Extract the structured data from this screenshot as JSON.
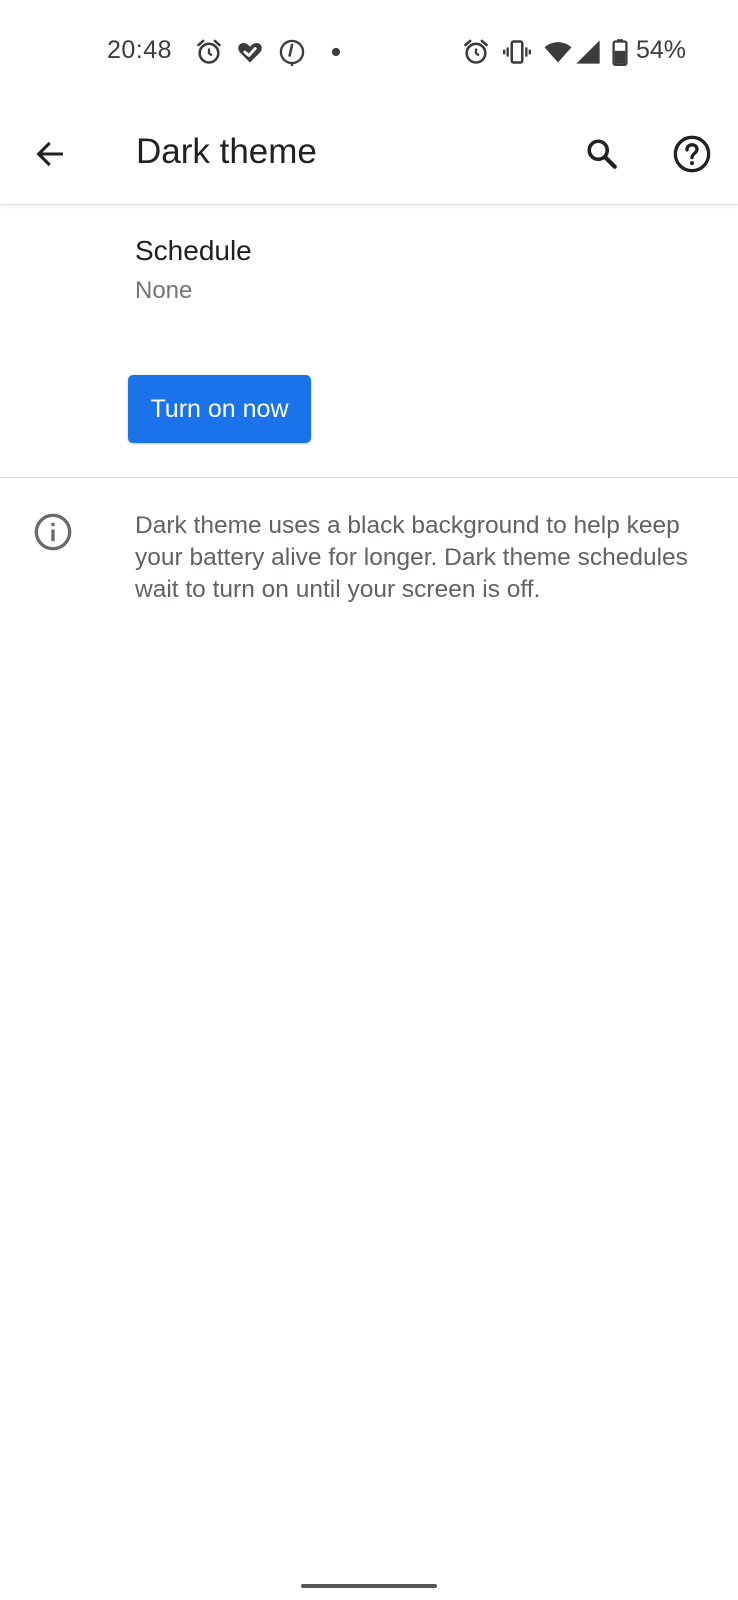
{
  "status_bar": {
    "time": "20:48",
    "battery_percent": "54%",
    "left_icons": [
      "alarm-icon",
      "heart-check-icon",
      "timer-icon",
      "notification-dot-icon"
    ],
    "right_icons": [
      "alarm-icon",
      "vibrate-icon",
      "wifi-icon",
      "cell-signal-icon",
      "battery-icon"
    ]
  },
  "app_bar": {
    "title": "Dark theme",
    "icons": [
      "back-arrow-icon",
      "search-icon",
      "help-icon"
    ]
  },
  "settings": {
    "schedule": {
      "title": "Schedule",
      "value": "None"
    },
    "turn_on_button": "Turn on now"
  },
  "info": {
    "icon": "info-icon",
    "text": "Dark theme uses a black background to help keep your battery alive for longer. Dark theme schedules wait to turn on until your screen is off."
  },
  "colors": {
    "accent": "#1a73e8",
    "title_text": "#202124",
    "secondary_text": "#757575",
    "icon_gray": "#5f6368"
  }
}
